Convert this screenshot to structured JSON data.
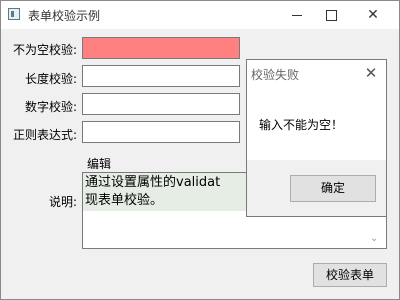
{
  "window": {
    "title": "表单校验示例"
  },
  "form": {
    "fields": [
      {
        "label": "不为空校验:",
        "value": ""
      },
      {
        "label": "长度校验:",
        "value": ""
      },
      {
        "label": "数字校验:",
        "value": ""
      },
      {
        "label": "正则表达式:",
        "value": ""
      }
    ],
    "edit_label": "编辑",
    "description_label": "说明:",
    "description_text": "通过设置属性的validat\n现表单校验。",
    "validate_button": "校验表单"
  },
  "dialog": {
    "title": "校验失败",
    "message": "输入不能为空！",
    "ok_button": "确定"
  },
  "colors": {
    "error_field": "#ff8080"
  }
}
